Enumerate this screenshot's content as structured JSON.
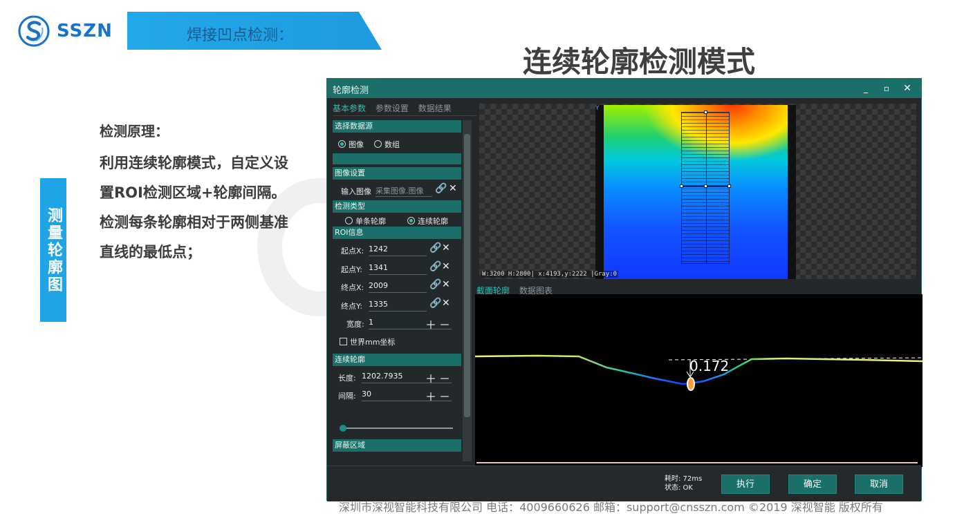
{
  "slide": {
    "logo_text": "SSZN",
    "banner_title": "焊接凹点检测：",
    "main_heading": "连续轮廓检测模式",
    "vertical_tab": "测量轮廓图",
    "principle_title": "检测原理：",
    "principle_body": "利用连续轮廓模式，自定义设置ROI检测区域+轮廓间隔。检测每条轮廓相对于两侧基准直线的最低点；",
    "footer": "深圳市深视智能科技有限公司  电话：4009660626  邮箱：support@cnsszn.com ©2019 深视智能 版权所有"
  },
  "window": {
    "title": "轮廓检测",
    "min_label": "_",
    "max_label": "▫",
    "close_label": "✕"
  },
  "left_tabs": [
    "基本参数",
    "参数设置",
    "数据结果"
  ],
  "panel": {
    "data_source_head": "选择数据源",
    "source_image": "图像",
    "source_array": "数组",
    "image_settings_head": "图像设置",
    "input_image_label": "输入图像",
    "input_image_placeholder": "采集图像.图像",
    "detect_type_head": "检测类型",
    "single_profile": "单条轮廓",
    "continuous_profile": "连续轮廓",
    "roi_head": "ROI信息",
    "start_x_label": "起点X:",
    "start_x": "1242",
    "start_y_label": "起点Y:",
    "start_y": "1341",
    "end_x_label": "终点X:",
    "end_x": "2009",
    "end_y_label": "终点Y:",
    "end_y": "1335",
    "width_label": "宽度:",
    "width": "1",
    "world_mm_label": "世界mm坐标",
    "continuous_head": "连续轮廓",
    "length_label": "长度:",
    "length": "1202.7935",
    "interval_label": "间隔:",
    "interval": "30",
    "mask_head": "屏蔽区域"
  },
  "viewer": {
    "status": "W:3200 H:2800| x:4193,y:2222 |Gray:0",
    "y_mark": "Y"
  },
  "profile_tabs": [
    "截面轮廓",
    "数据图表"
  ],
  "profile": {
    "value_label": "0.172"
  },
  "bottom": {
    "time_label": "耗时: 72ms",
    "state_label": "状态: OK",
    "run_button": "执行",
    "ok_button": "确定",
    "cancel_button": "取消"
  },
  "colors": {
    "accent_teal": "#1a6f68",
    "active_tab": "#2cc0b1",
    "banner_blue": "#22a8ea",
    "brand_blue": "#1a73c8"
  }
}
